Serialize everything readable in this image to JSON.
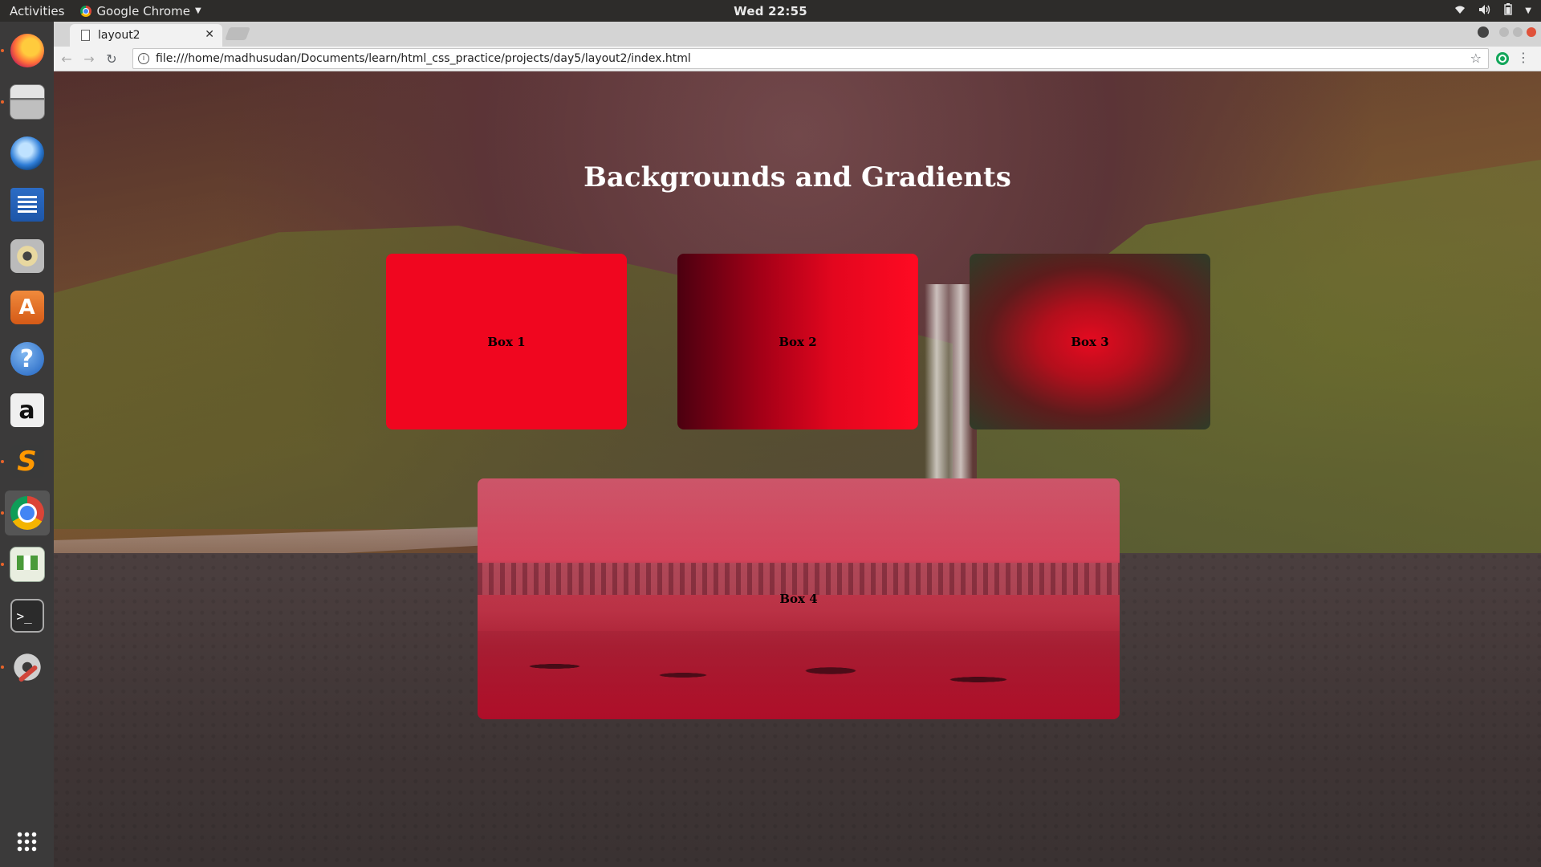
{
  "system": {
    "activities": "Activities",
    "app_name": "Google Chrome",
    "clock": "Wed 22:55"
  },
  "dock": {
    "items": [
      "firefox",
      "files",
      "thunderbird",
      "libreoffice-writer",
      "rhythmbox",
      "ubuntu-software",
      "help",
      "amazon",
      "sublime-text",
      "google-chrome",
      "libreoffice-calc",
      "terminal",
      "system-settings"
    ],
    "active": "google-chrome"
  },
  "browser": {
    "tab_title": "layout2",
    "url": "file:///home/madhusudan/Documents/learn/html_css_practice/projects/day5/layout2/index.html"
  },
  "page": {
    "heading": "Backgrounds and Gradients",
    "boxes": [
      "Box 1",
      "Box 2",
      "Box 3",
      "Box 4"
    ]
  },
  "colors": {
    "box1": "#f0061f",
    "box2_start": "#4b0010",
    "box2_end": "#ff0a22",
    "box3_center": "#e60a20",
    "box3_edge": "#2f3c28",
    "overlay": "#dc1432"
  }
}
